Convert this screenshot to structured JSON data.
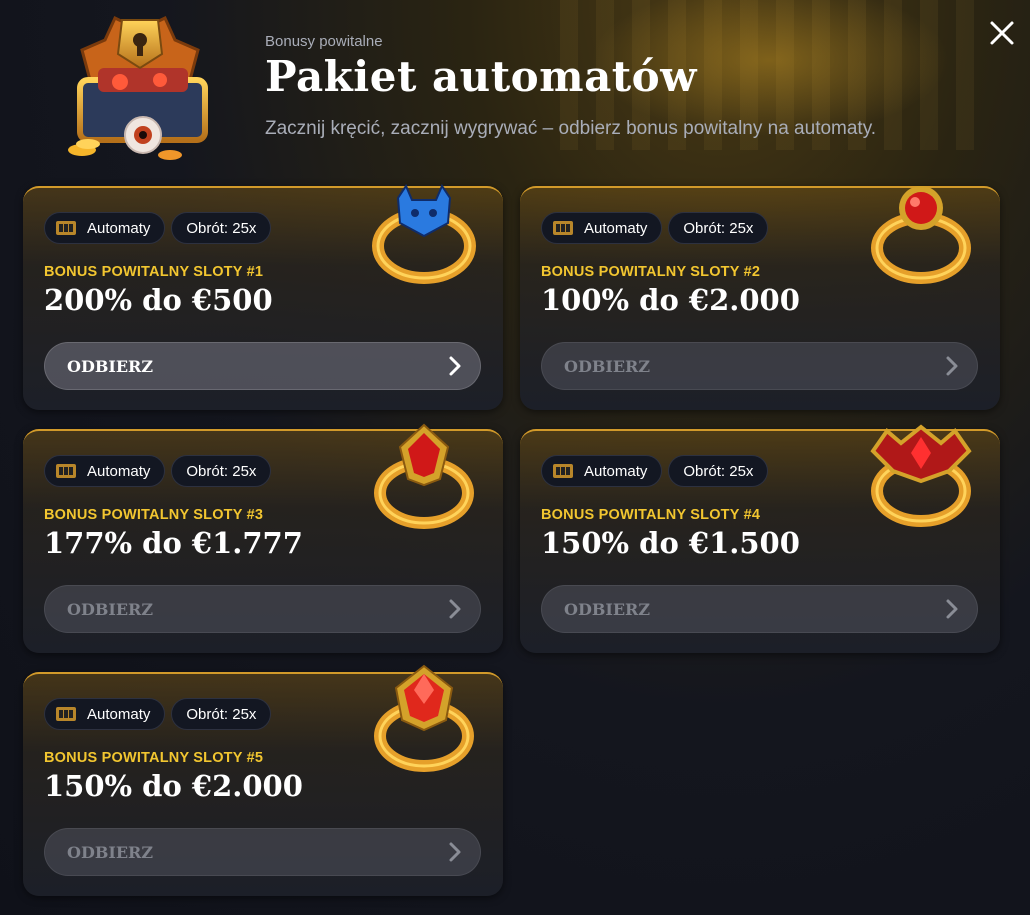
{
  "header": {
    "subtitle": "Bonusy powitalne",
    "title": "Pakiet automatów",
    "description": "Zacznij kręcić, zacznij wygrywać – odbierz bonus powitalny na automaty."
  },
  "colors": {
    "accent_gold": "#f2c630",
    "card_border": "#d29a2a",
    "background": "#14161e"
  },
  "bonuses": [
    {
      "category_tag": "Automaty",
      "wager_tag": "Obrót: 25x",
      "name": "BONUS POWITALNY SLOTY #1",
      "amount": "200% do €500",
      "button_label": "ODBIERZ",
      "active": true,
      "ring_icon": "devil-ring-icon"
    },
    {
      "category_tag": "Automaty",
      "wager_tag": "Obrót: 25x",
      "name": "BONUS POWITALNY SLOTY #2",
      "amount": "100% do €2.000",
      "button_label": "ODBIERZ",
      "active": false,
      "ring_icon": "ruby-ring-icon"
    },
    {
      "category_tag": "Automaty",
      "wager_tag": "Obrót: 25x",
      "name": "BONUS POWITALNY SLOTY #3",
      "amount": "177% do €1.777",
      "button_label": "ODBIERZ",
      "active": false,
      "ring_icon": "crystal-ring-icon"
    },
    {
      "category_tag": "Automaty",
      "wager_tag": "Obrót: 25x",
      "name": "BONUS POWITALNY SLOTY #4",
      "amount": "150% do €1.500",
      "button_label": "ODBIERZ",
      "active": false,
      "ring_icon": "bat-ring-icon"
    },
    {
      "category_tag": "Automaty",
      "wager_tag": "Obrót: 25x",
      "name": "BONUS POWITALNY SLOTY #5",
      "amount": "150% do €2.000",
      "button_label": "ODBIERZ",
      "active": false,
      "ring_icon": "gem-ring-icon"
    }
  ]
}
